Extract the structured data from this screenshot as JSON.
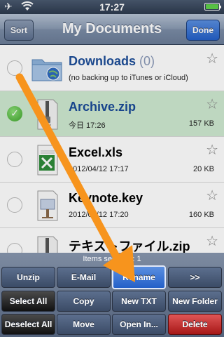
{
  "status_bar": {
    "time": "17:27",
    "airplane_icon": "airplane-icon",
    "wifi_icon": "wifi-icon",
    "battery_icon": "battery-icon",
    "battery_level": 1.0
  },
  "nav": {
    "title": "My Documents",
    "sort_label": "Sort",
    "done_label": "Done"
  },
  "files": [
    {
      "name": "Downloads",
      "count": "(0)",
      "subtitle": "(no backing up to iTunes or iCloud)",
      "size": "",
      "type": "folder",
      "selected": false,
      "icon": "folder-icon"
    },
    {
      "name": "Archive.zip",
      "count": "",
      "subtitle": "今日 17:26",
      "size": "157 KB",
      "type": "zip",
      "selected": true,
      "icon": "zip-file-icon"
    },
    {
      "name": "Excel.xls",
      "count": "",
      "subtitle": "2012/04/12 17:17",
      "size": "20 KB",
      "type": "xls",
      "selected": false,
      "icon": "excel-file-icon"
    },
    {
      "name": "Keynote.key",
      "count": "",
      "subtitle": "2012/04/12 17:20",
      "size": "160 KB",
      "type": "key",
      "selected": false,
      "icon": "keynote-file-icon"
    },
    {
      "name": "テキストファイル.zip",
      "count": "",
      "subtitle": "",
      "size": "",
      "type": "zip",
      "selected": false,
      "icon": "zip-file-icon"
    }
  ],
  "toolbar": {
    "info": "Items selected: 1",
    "buttons": [
      {
        "label": "Unzip",
        "style": "blue"
      },
      {
        "label": "E-Mail",
        "style": "blue"
      },
      {
        "label": "Rename",
        "style": "primary"
      },
      {
        "label": ">>",
        "style": "blue"
      },
      {
        "label": "Select All",
        "style": "black"
      },
      {
        "label": "Copy",
        "style": "blue"
      },
      {
        "label": "New TXT",
        "style": "blue"
      },
      {
        "label": "New Folder",
        "style": "blue"
      },
      {
        "label": "Deselect All",
        "style": "black"
      },
      {
        "label": "Move",
        "style": "blue"
      },
      {
        "label": "Open In...",
        "style": "blue"
      },
      {
        "label": "Delete",
        "style": "red"
      }
    ]
  },
  "colors": {
    "accent_blue": "#2460c8",
    "selected_row": "#cfead1",
    "arrow": "#f7941d",
    "delete_red": "#c62828"
  }
}
